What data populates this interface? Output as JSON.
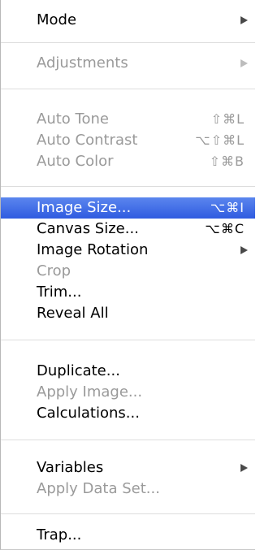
{
  "menu": {
    "mode": {
      "label": "Mode"
    },
    "adjustments": {
      "label": "Adjustments"
    },
    "auto_tone": {
      "label": "Auto Tone",
      "shortcut": "⇧⌘L"
    },
    "auto_contrast": {
      "label": "Auto Contrast",
      "shortcut": "⌥⇧⌘L"
    },
    "auto_color": {
      "label": "Auto Color",
      "shortcut": "⇧⌘B"
    },
    "image_size": {
      "label": "Image Size...",
      "shortcut": "⌥⌘I"
    },
    "canvas_size": {
      "label": "Canvas Size...",
      "shortcut": "⌥⌘C"
    },
    "image_rotation": {
      "label": "Image Rotation"
    },
    "crop": {
      "label": "Crop"
    },
    "trim": {
      "label": "Trim..."
    },
    "reveal_all": {
      "label": "Reveal All"
    },
    "duplicate": {
      "label": "Duplicate..."
    },
    "apply_image": {
      "label": "Apply Image..."
    },
    "calculations": {
      "label": "Calculations..."
    },
    "variables": {
      "label": "Variables"
    },
    "apply_data_set": {
      "label": "Apply Data Set..."
    },
    "trap": {
      "label": "Trap..."
    }
  },
  "colors": {
    "highlight": "#3a66e6",
    "disabled_text": "#9a9a9a",
    "text": "#000000"
  }
}
